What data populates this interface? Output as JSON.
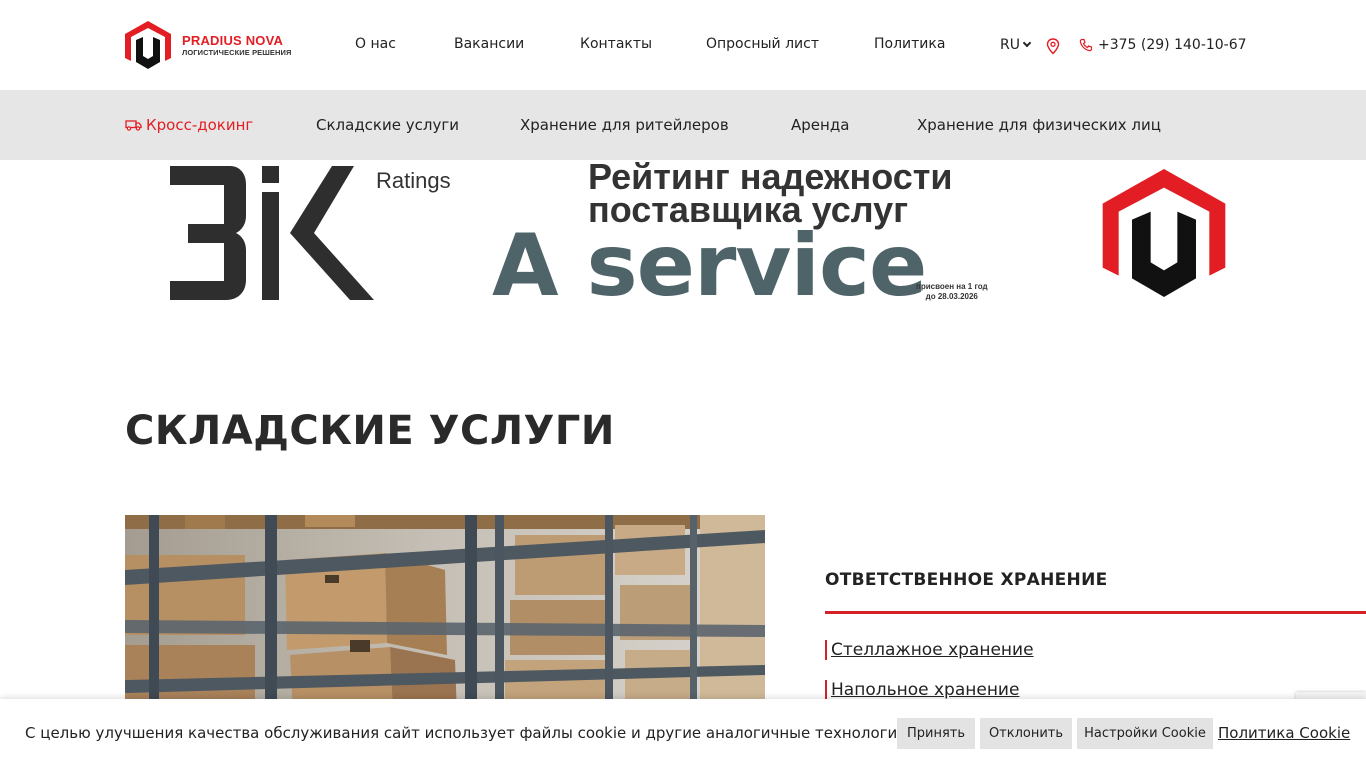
{
  "brand": {
    "name": "PRADIUS NOVA",
    "tagline": "ЛОГИСТИЧЕСКИЕ РЕШЕНИЯ",
    "red": "#e21e24"
  },
  "top_nav": {
    "items": [
      "О нас",
      "Вакансии",
      "Контакты",
      "Опросный лист",
      "Политика"
    ],
    "language": "RU",
    "location_icon": "map-pin-icon",
    "phone": "+375 (29) 140-10-67"
  },
  "sub_nav": {
    "items": [
      {
        "label": "Кросс-докинг",
        "icon": "truck-icon",
        "active": true
      },
      {
        "label": "Складские услуги",
        "active": false
      },
      {
        "label": "Хранение для ритейлеров",
        "active": false
      },
      {
        "label": "Аренда",
        "active": false
      },
      {
        "label": "Хранение для физических лиц",
        "active": false
      }
    ]
  },
  "banner": {
    "ratings_word": "Ratings",
    "title_line1": "Рейтинг надежности",
    "title_line2": "поставщика услуг",
    "rating": "A service",
    "assigned_line1": "присвоен на 1 год",
    "assigned_line2": "до 28.03.2026"
  },
  "page": {
    "title": "СКЛАДСКИЕ УСЛУГИ"
  },
  "side_menu": {
    "title": "ОТВЕТСТВЕННОЕ ХРАНЕНИЕ",
    "items": [
      "Стеллажное хранение",
      "Напольное хранение"
    ]
  },
  "cookie": {
    "text": "С целью улучшения качества обслуживания сайт использует файлы cookie и другие аналогичные технологии.",
    "accept": "Принять",
    "decline": "Отклонить",
    "settings": "Настройки Cookie",
    "policy": "Политика Cookie"
  }
}
